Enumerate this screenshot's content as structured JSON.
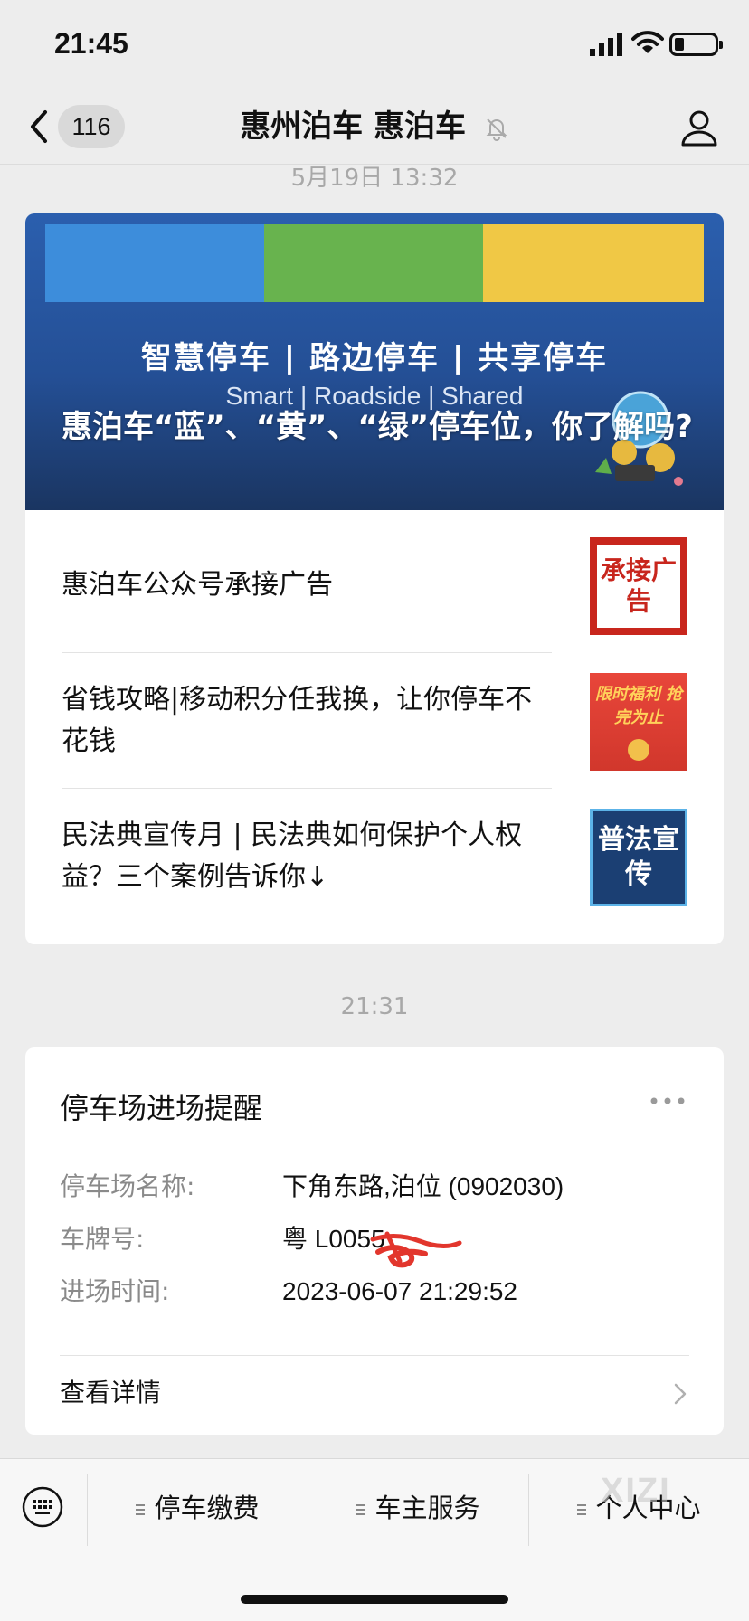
{
  "status_bar": {
    "time": "21:45"
  },
  "nav": {
    "badge_count": "116",
    "title": "惠州泊车 惠泊车"
  },
  "timestamps": {
    "first": "5月19日 13:32",
    "second": "21:31"
  },
  "article_card": {
    "cover": {
      "slogan": "智慧停车 | 路边停车 | 共享停车",
      "slogan_en": "Smart | Roadside | Shared",
      "title": "惠泊车“蓝”、“黄”、“绿”停车位，你了解吗?"
    },
    "items": [
      {
        "title": "惠泊车公众号承接广告",
        "thumb_text": "承接广告"
      },
      {
        "title": "省钱攻略|移动积分任我换，让你停车不花钱",
        "thumb_text": "限时福利 抢完为止"
      },
      {
        "title": "民法典宣传月 | 民法典如何保护个人权益？三个案例告诉你↓",
        "thumb_text": "普法宣传"
      }
    ]
  },
  "parking_card": {
    "title": "停车场进场提醒",
    "rows": [
      {
        "label": "停车场名称:",
        "value": "下角东路,泊位 (0902030)"
      },
      {
        "label": "车牌号:",
        "value": "粤 L0055"
      },
      {
        "label": "进场时间:",
        "value": "2023-06-07 21:29:52"
      }
    ],
    "detail_label": "查看详情"
  },
  "menu": {
    "items": [
      "停车缴费",
      "车主服务",
      "个人中心"
    ],
    "watermark": "XIZI"
  }
}
